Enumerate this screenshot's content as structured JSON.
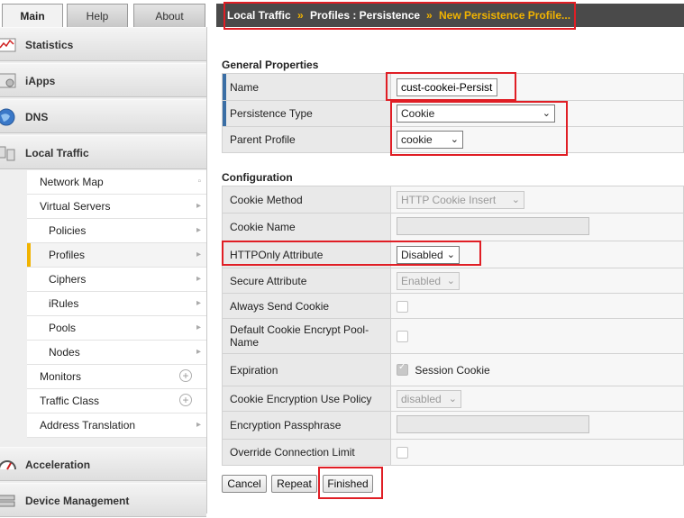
{
  "tabs": {
    "main": "Main",
    "help": "Help",
    "about": "About"
  },
  "sidebar": {
    "sections": [
      {
        "label": "Statistics",
        "icon": "statistics-icon"
      },
      {
        "label": "iApps",
        "icon": "iapps-icon"
      },
      {
        "label": "DNS",
        "icon": "dns-globe-icon"
      },
      {
        "label": "Local Traffic",
        "icon": "local-traffic-icon"
      },
      {
        "label": "Acceleration",
        "icon": "acceleration-gauge-icon"
      },
      {
        "label": "Device Management",
        "icon": "device-management-icon"
      }
    ],
    "items": [
      {
        "label": "Network Map"
      },
      {
        "label": "Virtual Servers"
      },
      {
        "label": "Policies"
      },
      {
        "label": "Profiles"
      },
      {
        "label": "Ciphers"
      },
      {
        "label": "iRules"
      },
      {
        "label": "Pools"
      },
      {
        "label": "Nodes"
      },
      {
        "label": "Monitors"
      },
      {
        "label": "Traffic Class"
      },
      {
        "label": "Address Translation"
      }
    ]
  },
  "breadcrumb": {
    "part1": "Local Traffic",
    "sep": "»",
    "part2": "Profiles : Persistence",
    "part3": "New Persistence Profile..."
  },
  "general": {
    "heading": "General Properties",
    "name_label": "Name",
    "name_value": "cust-cookei-Persist",
    "type_label": "Persistence Type",
    "type_value": "Cookie",
    "parent_label": "Parent Profile",
    "parent_value": "cookie"
  },
  "config": {
    "heading": "Configuration",
    "cookie_method_label": "Cookie Method",
    "cookie_method_value": "HTTP Cookie Insert",
    "cookie_name_label": "Cookie Name",
    "httponly_label": "HTTPOnly Attribute",
    "httponly_value": "Disabled",
    "secure_label": "Secure Attribute",
    "secure_value": "Enabled",
    "always_send_label": "Always Send Cookie",
    "encrypt_pool_label": "Default Cookie Encrypt Pool-Name",
    "expiration_label": "Expiration",
    "session_cookie_label": "Session Cookie",
    "encryption_policy_label": "Cookie Encryption Use Policy",
    "encryption_policy_value": "disabled",
    "passphrase_label": "Encryption Passphrase",
    "override_label": "Override Connection Limit"
  },
  "buttons": {
    "cancel": "Cancel",
    "repeat": "Repeat",
    "finished": "Finished"
  },
  "colors": {
    "highlight_red": "#e01e25",
    "breadcrumb_bg": "#4a4a4a",
    "breadcrumb_accent": "#f1b300",
    "active_item": "#f1b300"
  }
}
